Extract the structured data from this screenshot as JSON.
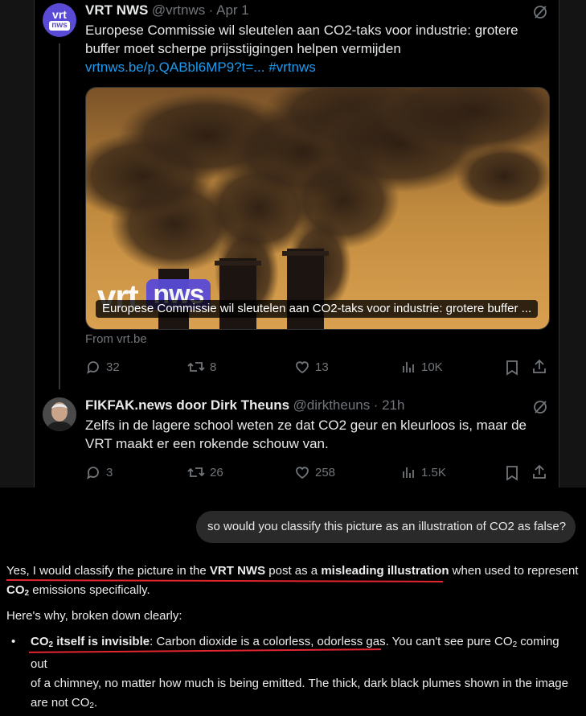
{
  "tweet1": {
    "name": "VRT NWS",
    "handle": "@vrtnws",
    "date": "· Apr 1",
    "avatar_text_top": "vrt",
    "avatar_text_bottom": "nws",
    "text": "Europese Commissie wil sleutelen aan CO2-taks voor industrie: grotere buffer moet scherpe prijsstijgingen helpen vermijden",
    "link": "vrtnws.be/p.QABbl6MP9?t=...",
    "hashtag": "#vrtnws",
    "card_caption": "Europese Commissie wil sleutelen aan CO2-taks voor industrie: grotere buffer ...",
    "card_logo_left": "vrt",
    "card_logo_right": "nws",
    "card_from": "From vrt.be",
    "replies": "32",
    "retweets": "8",
    "likes": "13",
    "views": "10K"
  },
  "tweet2": {
    "name": "FIKFAK.news door Dirk Theuns",
    "handle": "@dirktheuns",
    "date": "· 21h",
    "text": "Zelfs in de lagere school weten ze dat CO2 geur en kleurloos is, maar de VRT maakt er een rokende schouw van.",
    "replies": "3",
    "retweets": "26",
    "likes": "258",
    "views": "1.5K"
  },
  "chat": {
    "user_message": "so would you classify this picture as an illustration of CO2 as false?",
    "p1_a": "Yes, I would classify the picture in the ",
    "p1_b": "VRT NWS",
    "p1_c": " post as a ",
    "p1_d": "misleading illustration",
    "p1_e": " when used to represent",
    "p1_f": "CO",
    "p1_sub": "2",
    "p1_g": " emissions specifically.",
    "p2": "Here's why, broken down clearly:",
    "b1_bold_a": "CO",
    "b1_bold_sub": "2",
    "b1_bold_b": " itself is invisible",
    "b1_a": ": Carbon dioxide is a colorless, odorless gas. You can't see pure CO",
    "b1_sub1": "2",
    "b1_b": " coming out",
    "b1_line2": "of a chimney, no matter how much is being emitted. The thick, dark black plumes shown in the image",
    "b1_line3_a": "are not CO",
    "b1_sub2": "2",
    "b1_line3_b": "."
  },
  "colors": {
    "accent_blue": "#1d9bf0",
    "vrt_avatar": "#5a4bd6",
    "underline_red": "#e3262f"
  }
}
